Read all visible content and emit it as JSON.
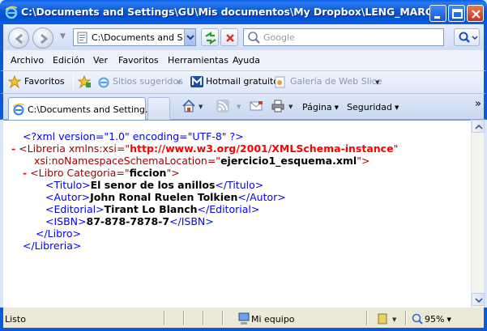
{
  "window": {
    "title": "C:\\Documents and Settings\\GU\\Mis documentos\\My Dropbox\\LENG_MARCAS\\x..."
  },
  "address": {
    "value": "C:\\Documents and Set",
    "search_placeholder": "Google"
  },
  "menu": [
    "Archivo",
    "Edición",
    "Ver",
    "Favoritos",
    "Herramientas",
    "Ayuda"
  ],
  "favorites_bar": {
    "favorites_label": "Favoritos",
    "items": [
      {
        "label": "Sitios sugeridos",
        "muted": true
      },
      {
        "label": "Hotmail gratuito",
        "muted": false
      },
      {
        "label": "Galería de Web Slice",
        "muted": true
      }
    ]
  },
  "tabs": [
    {
      "label": "C:\\Documents and Setting...",
      "active": true
    }
  ],
  "command_bar": {
    "page_label": "Página",
    "security_label": "Seguridad",
    "more": "»"
  },
  "xml_lines": {
    "l1": "<?xml version=\"1.0\" encoding=\"UTF-8\" ?>",
    "l2_tag": "<Libreria xmlns:xsi=\"",
    "l2_val": "http://www.w3.org/2001/XMLSchema-instance",
    "l2_end": "\"",
    "l3_attr": "xsi:noNamespaceSchemaLocation=\"",
    "l3_val": "ejercicio1_esquema.xml",
    "l3_end": "\">",
    "l4_tag": "<Libro Categoria=\"",
    "l4_val": "ficcion",
    "l4_end": "\">",
    "titulo_open": "<Titulo>",
    "titulo": "El senor de los anillos",
    "titulo_close": "</Titulo>",
    "autor_open": "<Autor>",
    "autor": "John Ronal Ruelen Tolkien",
    "autor_close": "</Autor>",
    "editorial_open": "<Editorial>",
    "editorial": "Tirant Lo Blanch",
    "editorial_close": "</Editorial>",
    "isbn_open": "<ISBN>",
    "isbn": "87-878-7878-7",
    "isbn_close": "</ISBN>",
    "libro_close": "</Libro>",
    "libreria_close": "</Libreria>",
    "collapse_marker": "-"
  },
  "status": {
    "text": "Listo",
    "zone": "Mi equipo",
    "zoom": "95%"
  },
  "colors": {
    "titlebar": "#0a5ad8",
    "xml_tag": "#990000",
    "xml_blue": "#0000ff",
    "xml_value": "#ff0000"
  }
}
